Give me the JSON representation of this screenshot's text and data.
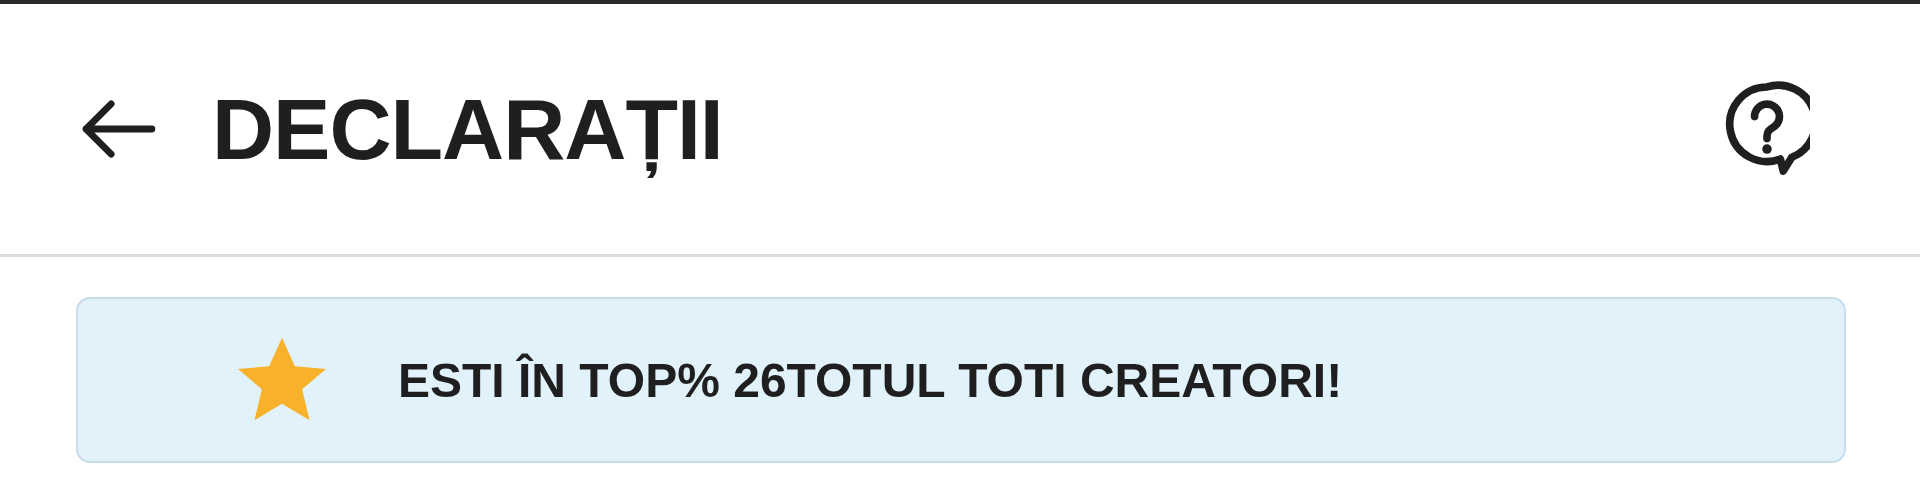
{
  "header": {
    "title": "DECLARAȚII"
  },
  "banner": {
    "text": "ESTI ÎN TOP% 26TOTUL TOTI CREATORI!"
  }
}
